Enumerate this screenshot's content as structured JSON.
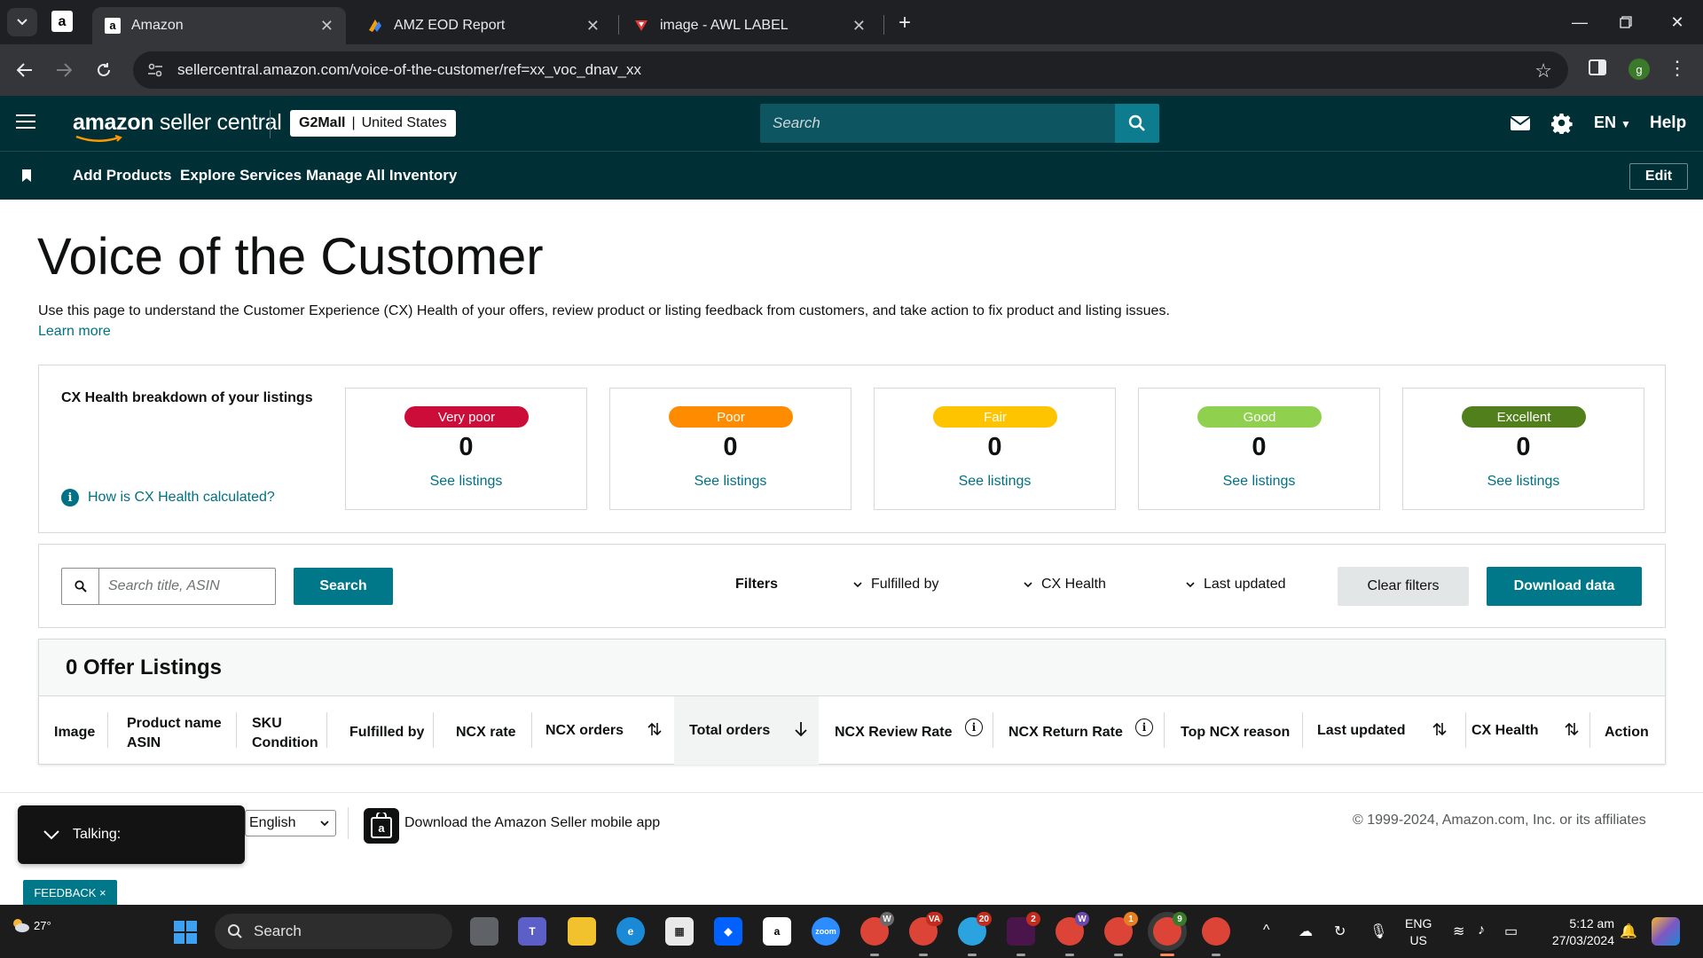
{
  "browser": {
    "tabs": [
      {
        "title": "Amazon",
        "active": true
      },
      {
        "title": "AMZ EOD Report",
        "active": false
      },
      {
        "title": "image - AWL LABEL",
        "active": false
      }
    ],
    "url": "sellercentral.amazon.com/voice-of-the-customer/ref=xx_voc_dnav_xx",
    "profile_initial": "g"
  },
  "header": {
    "logo_bold": "amazon",
    "logo_rest": " seller central",
    "store_name": "G2Mall",
    "marketplace": "United States",
    "search_placeholder": "Search",
    "language": "EN",
    "help": "Help"
  },
  "subnav": {
    "links": [
      "Add Products",
      "Explore Services",
      "Manage All Inventory"
    ],
    "edit": "Edit"
  },
  "page": {
    "title": "Voice of the Customer",
    "description": "Use this page to understand the Customer Experience (CX) Health of your offers, review product or listing feedback from customers, and take action to fix product and listing issues.",
    "learn_more": "Learn more"
  },
  "cx_health": {
    "title": "CX Health breakdown of your listings",
    "how_link": "How is CX Health calculated?",
    "cards": [
      {
        "label": "Very poor",
        "count": "0",
        "link": "See listings",
        "color": "#cc0c39"
      },
      {
        "label": "Poor",
        "count": "0",
        "link": "See listings",
        "color": "#ff8c00"
      },
      {
        "label": "Fair",
        "count": "0",
        "link": "See listings",
        "color": "#ffc400"
      },
      {
        "label": "Good",
        "count": "0",
        "link": "See listings",
        "color": "#8fd14f"
      },
      {
        "label": "Excellent",
        "count": "0",
        "link": "See listings",
        "color": "#507f1b"
      }
    ]
  },
  "filters": {
    "search_placeholder": "Search title, ASIN",
    "search_button": "Search",
    "label": "Filters",
    "dropdowns": [
      "Fulfilled by",
      "CX Health",
      "Last updated"
    ],
    "clear": "Clear filters",
    "download": "Download data"
  },
  "offers": {
    "title": "0 Offer Listings",
    "columns": {
      "image": "Image",
      "product_name": "Product name",
      "asin": "ASIN",
      "sku": "SKU",
      "condition": "Condition",
      "fulfilled_by": "Fulfilled by",
      "ncx_rate": "NCX rate",
      "ncx_orders": "NCX orders",
      "total_orders": "Total orders",
      "ncx_review_rate": "NCX Review Rate",
      "ncx_return_rate": "NCX Return Rate",
      "top_ncx_reason": "Top NCX reason",
      "last_updated": "Last updated",
      "cx_health": "CX Health",
      "action": "Action"
    }
  },
  "footer": {
    "talking": "Talking:",
    "language": "English",
    "app_link": "Download the Amazon Seller mobile app",
    "copyright": "© 1999-2024, Amazon.com, Inc. or its affiliates",
    "feedback": "FEEDBACK ×"
  },
  "taskbar": {
    "weather": "27°",
    "search": "Search",
    "lang_top": "ENG",
    "lang_bottom": "US",
    "time": "5:12 am",
    "date": "27/03/2024",
    "badges": {
      "telegram": "20",
      "slack": "2",
      "chrome_w1": "W",
      "chrome_va": "VA",
      "chrome_w2": "W",
      "chrome_1": "1",
      "chrome_9": "9"
    }
  }
}
